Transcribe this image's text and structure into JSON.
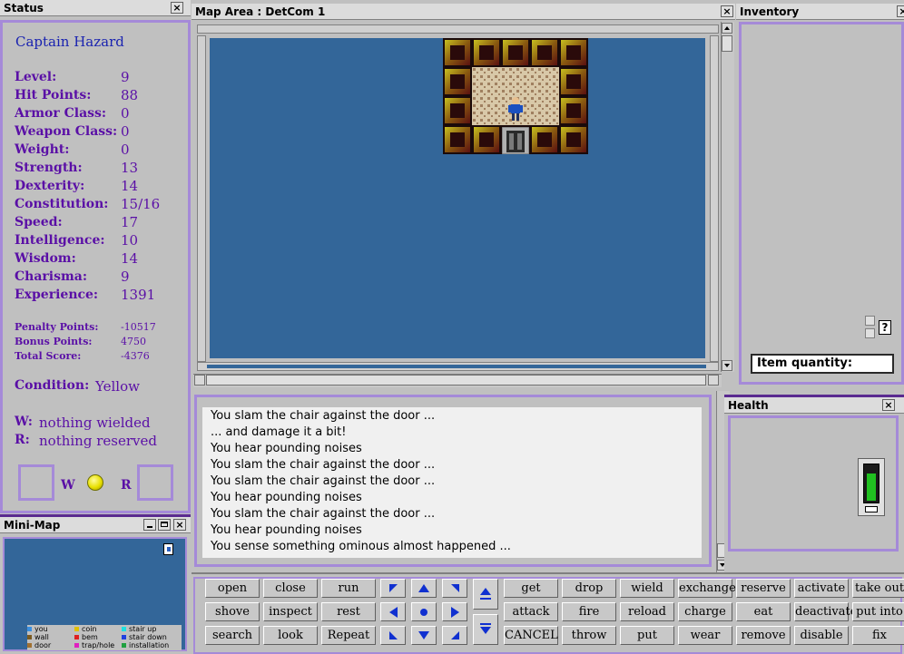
{
  "status": {
    "title": "Status",
    "name": "Captain Hazard",
    "stats": [
      {
        "label": "Level:",
        "value": "9"
      },
      {
        "label": "Hit Points:",
        "value": "88"
      },
      {
        "label": "Armor Class:",
        "value": "0"
      },
      {
        "label": "Weapon Class:",
        "value": "0"
      },
      {
        "label": "Weight:",
        "value": "0"
      },
      {
        "label": "Strength:",
        "value": "13"
      },
      {
        "label": "Dexterity:",
        "value": "14"
      },
      {
        "label": "Constitution:",
        "value": "15/16"
      },
      {
        "label": "Speed:",
        "value": "17"
      },
      {
        "label": "Intelligence:",
        "value": "10"
      },
      {
        "label": "Wisdom:",
        "value": "14"
      },
      {
        "label": "Charisma:",
        "value": "9"
      },
      {
        "label": "Experience:",
        "value": "1391"
      }
    ],
    "points": [
      {
        "label": "Penalty Points:",
        "value": "-10517"
      },
      {
        "label": "Bonus Points:",
        "value": "4750"
      },
      {
        "label": "Total Score:",
        "value": "-4376"
      }
    ],
    "condition_label": "Condition:",
    "condition_value": "Yellow",
    "wielded_label": "W:",
    "wielded_value": "nothing wielded",
    "reserved_label": "R:",
    "reserved_value": "nothing reserved",
    "slot_w": "W",
    "slot_r": "R",
    "condition_color": "#e8e000"
  },
  "minimap": {
    "title": "Mini-Map",
    "legend": [
      {
        "label": "you",
        "color": "#3a8fe0"
      },
      {
        "label": "wall",
        "color": "#7a5a20"
      },
      {
        "label": "door",
        "color": "#a07030"
      },
      {
        "label": "coin",
        "color": "#e0c000"
      },
      {
        "label": "bem",
        "color": "#e02020"
      },
      {
        "label": "trap/hole",
        "color": "#e020c0"
      },
      {
        "label": "stair up",
        "color": "#20e0e0"
      },
      {
        "label": "stair down",
        "color": "#2040e0"
      },
      {
        "label": "installation",
        "color": "#20a040"
      }
    ]
  },
  "map": {
    "title": "Map Area : DetCom 1",
    "background": "#336699"
  },
  "inventory": {
    "title": "Inventory",
    "quantity_label": "Item quantity:",
    "help": "?"
  },
  "health": {
    "title": "Health",
    "level": 0.8
  },
  "messages": [
    "You slam the chair against the door ...",
    "... and damage it a bit!",
    "You hear pounding noises",
    "You slam the chair against the door ...",
    "You slam the chair against the door ...",
    "You hear pounding noises",
    "You slam the chair against the door ...",
    "You hear pounding noises",
    "You sense something ominous almost happened ..."
  ],
  "commands": {
    "left": [
      [
        "open",
        "close",
        "run"
      ],
      [
        "shove",
        "inspect",
        "rest"
      ],
      [
        "search",
        "look",
        "Repeat"
      ]
    ],
    "right": [
      [
        "get",
        "drop",
        "wield",
        "exchange",
        "reserve",
        "activate",
        "take out"
      ],
      [
        "attack",
        "fire",
        "reload",
        "charge",
        "eat",
        "deactivate",
        "put into"
      ],
      [
        "CANCEL",
        "throw",
        "put",
        "wear",
        "remove",
        "disable",
        "fix"
      ]
    ]
  },
  "icons": {
    "close": "×"
  }
}
